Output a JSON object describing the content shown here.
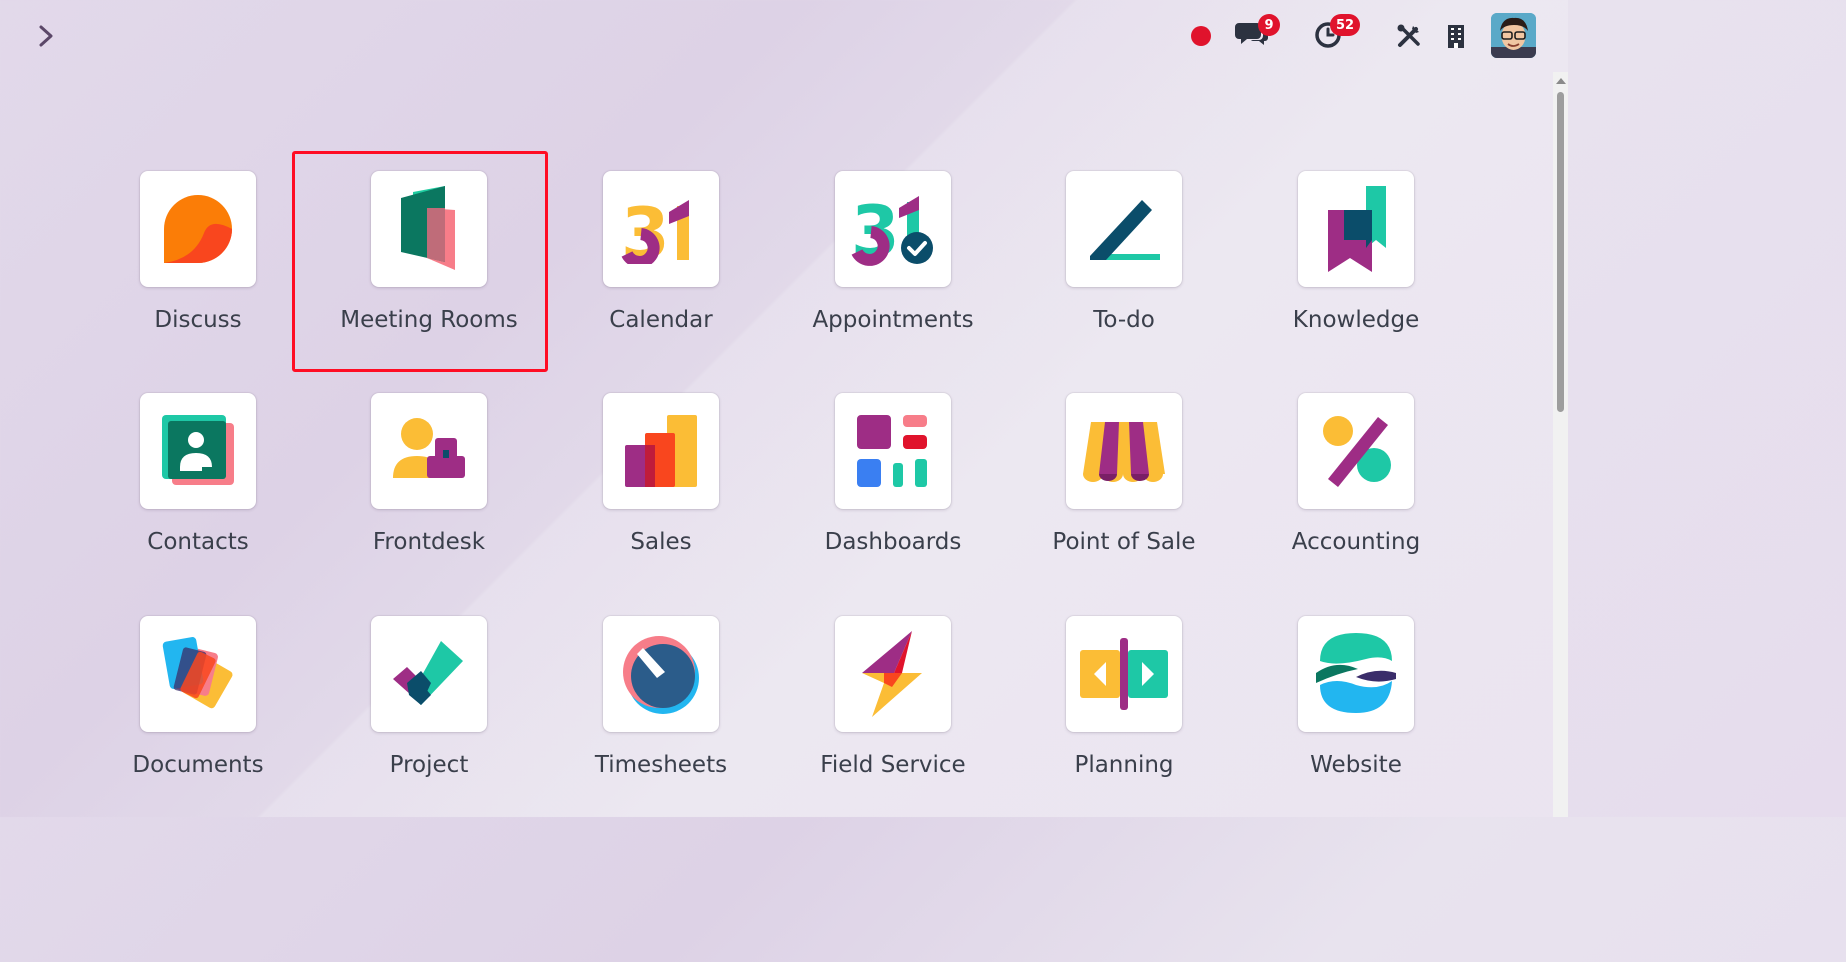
{
  "topbar": {
    "expand_icon": "chevron-right-icon",
    "status_dot_color": "#e0132c",
    "messages_badge": "9",
    "activities_badge": "52",
    "icons": [
      "status-dot-icon",
      "chat-icon",
      "clock-icon",
      "tools-icon",
      "building-icon",
      "avatar"
    ]
  },
  "apps": [
    {
      "label": "Discuss",
      "icon": "discuss-icon"
    },
    {
      "label": "Meeting Rooms",
      "icon": "meeting-rooms-icon"
    },
    {
      "label": "Calendar",
      "icon": "calendar-icon"
    },
    {
      "label": "Appointments",
      "icon": "appointments-icon"
    },
    {
      "label": "To-do",
      "icon": "todo-icon"
    },
    {
      "label": "Knowledge",
      "icon": "knowledge-icon"
    },
    {
      "label": "Contacts",
      "icon": "contacts-icon"
    },
    {
      "label": "Frontdesk",
      "icon": "frontdesk-icon"
    },
    {
      "label": "Sales",
      "icon": "sales-icon"
    },
    {
      "label": "Dashboards",
      "icon": "dashboards-icon"
    },
    {
      "label": "Point of Sale",
      "icon": "point-of-sale-icon"
    },
    {
      "label": "Accounting",
      "icon": "accounting-icon"
    },
    {
      "label": "Documents",
      "icon": "documents-icon"
    },
    {
      "label": "Project",
      "icon": "project-icon"
    },
    {
      "label": "Timesheets",
      "icon": "timesheets-icon"
    },
    {
      "label": "Field Service",
      "icon": "field-service-icon"
    },
    {
      "label": "Planning",
      "icon": "planning-icon"
    },
    {
      "label": "Website",
      "icon": "website-icon"
    }
  ],
  "calendar_day": "31",
  "highlight_color": "#ff0d24"
}
